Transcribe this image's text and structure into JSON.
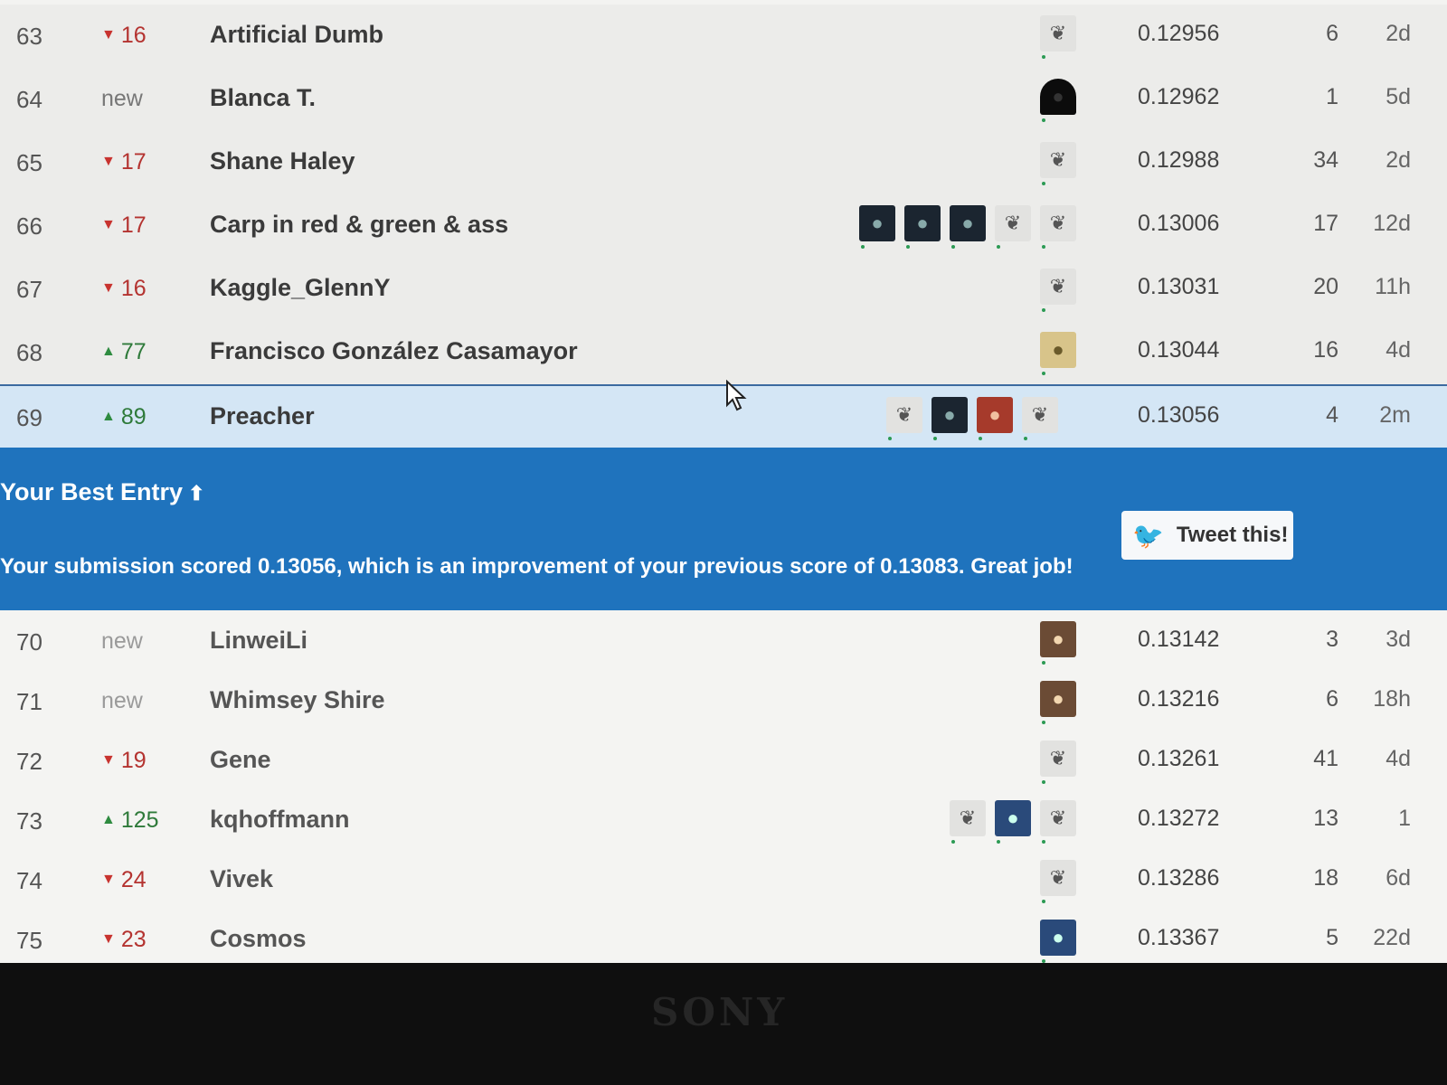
{
  "leaderboard": {
    "rows_upper": [
      {
        "rank": "63",
        "direction": "down",
        "delta": "16",
        "name": "Artificial Dumb",
        "score": "0.12956",
        "entries": "6",
        "last": "2d",
        "avatars": [
          "bird"
        ]
      },
      {
        "rank": "64",
        "direction": "new",
        "delta": "new",
        "name": "Blanca T.",
        "score": "0.12962",
        "entries": "1",
        "last": "5d",
        "avatars": [
          "black"
        ]
      },
      {
        "rank": "65",
        "direction": "down",
        "delta": "17",
        "name": "Shane Haley",
        "score": "0.12988",
        "entries": "34",
        "last": "2d",
        "avatars": [
          "bird"
        ]
      },
      {
        "rank": "66",
        "direction": "down",
        "delta": "17",
        "name": "Carp in red & green & ass",
        "score": "0.13006",
        "entries": "17",
        "last": "12d",
        "avatars": [
          "dark",
          "dark",
          "dark",
          "bird",
          "bird"
        ]
      },
      {
        "rank": "67",
        "direction": "down",
        "delta": "16",
        "name": "Kaggle_GlennY",
        "score": "0.13031",
        "entries": "20",
        "last": "11h",
        "avatars": [
          "bird"
        ]
      },
      {
        "rank": "68",
        "direction": "up",
        "delta": "77",
        "name": "Francisco González Casamayor",
        "score": "0.13044",
        "entries": "16",
        "last": "4d",
        "avatars": [
          "tan"
        ]
      }
    ],
    "highlight_row": {
      "rank": "69",
      "direction": "up",
      "delta": "89",
      "name": "Preacher",
      "score": "0.13056",
      "entries": "4",
      "last": "2m",
      "avatars": [
        "bird",
        "dark",
        "red",
        "bird"
      ]
    },
    "best_entry": {
      "title": "Your Best Entry",
      "message": "Your submission scored 0.13056, which is an improvement of your previous score of 0.13083. Great job!",
      "tweet_label": "Tweet this!"
    },
    "rows_lower": [
      {
        "rank": "70",
        "direction": "new",
        "delta": "new",
        "name": "LinweiLi",
        "score": "0.13142",
        "entries": "3",
        "last": "3d",
        "avatars": [
          "photo"
        ]
      },
      {
        "rank": "71",
        "direction": "new",
        "delta": "new",
        "name": "Whimsey Shire",
        "score": "0.13216",
        "entries": "6",
        "last": "18h",
        "avatars": [
          "photo"
        ]
      },
      {
        "rank": "72",
        "direction": "down",
        "delta": "19",
        "name": "Gene",
        "score": "0.13261",
        "entries": "41",
        "last": "4d",
        "avatars": [
          "bird"
        ]
      },
      {
        "rank": "73",
        "direction": "up",
        "delta": "125",
        "name": "kqhoffmann",
        "score": "0.13272",
        "entries": "13",
        "last": "1",
        "avatars": [
          "bird",
          "blue",
          "bird"
        ]
      },
      {
        "rank": "74",
        "direction": "down",
        "delta": "24",
        "name": "Vivek",
        "score": "0.13286",
        "entries": "18",
        "last": "6d",
        "avatars": [
          "bird"
        ]
      },
      {
        "rank": "75",
        "direction": "down",
        "delta": "23",
        "name": "Cosmos",
        "score": "0.13367",
        "entries": "5",
        "last": "22d",
        "avatars": [
          "blue"
        ]
      }
    ]
  },
  "bezel": {
    "logo": "SONY"
  }
}
